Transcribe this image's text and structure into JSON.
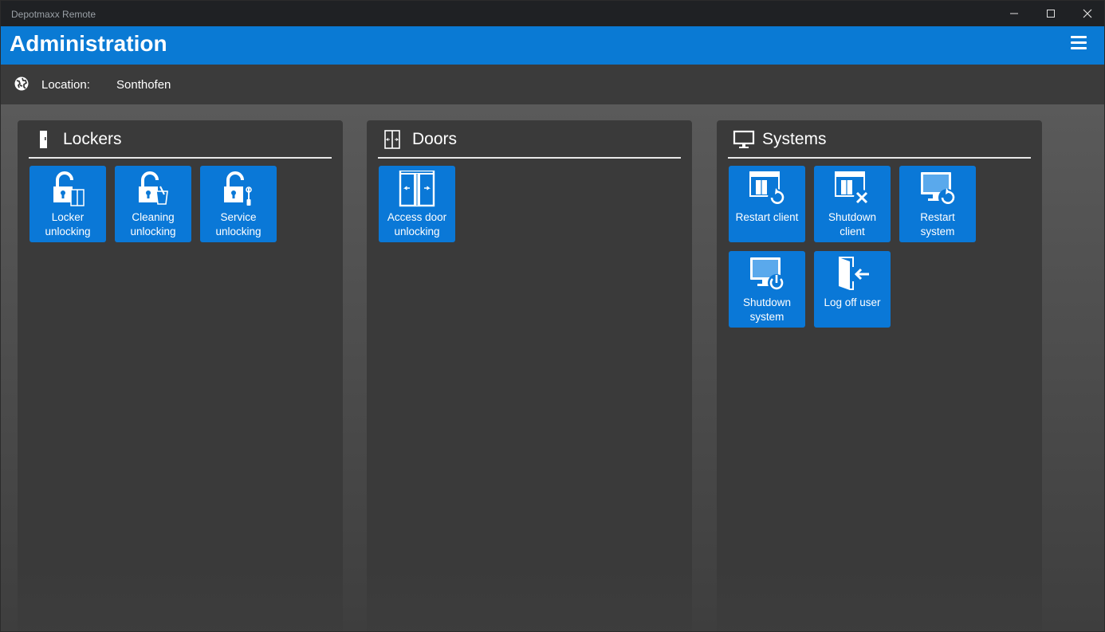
{
  "window": {
    "title": "Depotmaxx Remote"
  },
  "appbar": {
    "heading": "Administration"
  },
  "location": {
    "label": "Location:",
    "value": "Sonthofen"
  },
  "panels": [
    {
      "title": "Lockers",
      "tiles": [
        {
          "label_line1": "Locker",
          "label_line2": "unlocking",
          "icon": "padlock-locker-icon"
        },
        {
          "label_line1": "Cleaning",
          "label_line2": "unlocking",
          "icon": "padlock-cleaning-icon"
        },
        {
          "label_line1": "Service",
          "label_line2": "unlocking",
          "icon": "padlock-service-icon"
        }
      ]
    },
    {
      "title": "Doors",
      "tiles": [
        {
          "label_line1": "Access door",
          "label_line2": "unlocking",
          "icon": "sliding-door-icon"
        }
      ]
    },
    {
      "title": "Systems",
      "tiles": [
        {
          "label_line1": "Restart client",
          "label_line2": "",
          "icon": "client-restart-icon"
        },
        {
          "label_line1": "Shutdown",
          "label_line2": "client",
          "icon": "client-shutdown-icon"
        },
        {
          "label_line1": "Restart",
          "label_line2": "system",
          "icon": "monitor-restart-icon"
        },
        {
          "label_line1": "Shutdown",
          "label_line2": "system",
          "icon": "monitor-power-icon"
        },
        {
          "label_line1": "Log off user",
          "label_line2": "",
          "icon": "logoff-door-icon"
        }
      ]
    }
  ],
  "colors": {
    "accent": "#0a7ad4",
    "tile": "#0a78d7",
    "panel": "#3a3a3a",
    "titlebar": "#1f2124"
  }
}
